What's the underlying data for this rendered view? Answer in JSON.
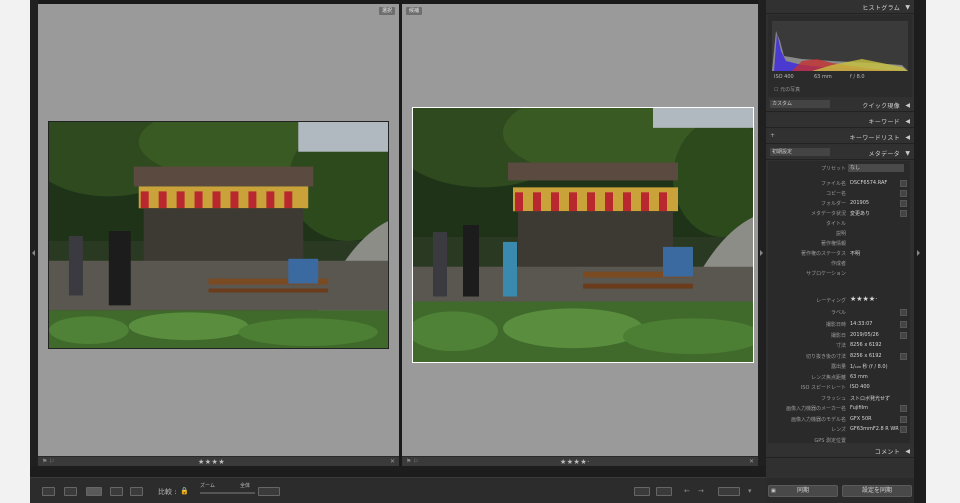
{
  "compare": {
    "left_tag": "選択",
    "right_tag": "候補",
    "left_rating": "★★★★",
    "right_rating": "★★★★·"
  },
  "toolbar": {
    "compare_label": "比較 :",
    "zoom_label": "ズーム",
    "fit_label": "全体"
  },
  "histogram": {
    "title": "ヒストグラム",
    "iso": "ISO 400",
    "focal": "63 mm",
    "aperture": "f / 8.0",
    "original": "元の写真"
  },
  "panels": {
    "quick_develop": "クイック現像",
    "custom": "カスタム",
    "keywords": "キーワード",
    "keyword_list": "キーワードリスト",
    "metadata": "メタデータ",
    "default_preset": "初期設定",
    "comments": "コメント"
  },
  "metadata": {
    "preset_label": "プリセット",
    "preset_value": "なし",
    "rows": [
      {
        "k": "ファイル名",
        "v": "DSCF6574.RAF"
      },
      {
        "k": "コピー名",
        "v": ""
      },
      {
        "k": "フォルダー",
        "v": "201905"
      },
      {
        "k": "メタデータ状況",
        "v": "変更あり"
      },
      {
        "k": "タイトル",
        "v": ""
      },
      {
        "k": "説明",
        "v": ""
      },
      {
        "k": "著作権情報",
        "v": ""
      },
      {
        "k": "著作権のステータス",
        "v": "不明"
      },
      {
        "k": "作成者",
        "v": ""
      },
      {
        "k": "サブロケーション",
        "v": ""
      }
    ],
    "rating_label": "レーティング",
    "rating_value": "★★★★·",
    "label_label": "ラベル",
    "rows2": [
      {
        "k": "撮影日時",
        "v": "14:33:07"
      },
      {
        "k": "撮影日",
        "v": "2019/05/26"
      },
      {
        "k": "寸法",
        "v": "8256 x 6192"
      },
      {
        "k": "切り抜き後の寸法",
        "v": "8256 x 6192"
      },
      {
        "k": "露出量",
        "v": "1/₁₀₀ 秒 (f / 8.0)"
      },
      {
        "k": "レンズ焦点距離",
        "v": "63 mm"
      },
      {
        "k": "ISO スピードレート",
        "v": "ISO 400"
      },
      {
        "k": "フラッシュ",
        "v": "ストロボ発光せず"
      },
      {
        "k": "画像入力機器のメーカー名",
        "v": "Fujifilm"
      },
      {
        "k": "画像入力機器のモデル名",
        "v": "GFX 50R"
      },
      {
        "k": "レンズ",
        "v": "GF63mmF2.8 R WR"
      },
      {
        "k": "GPS 測定位置",
        "v": ""
      }
    ]
  },
  "buttons": {
    "sync": "同期",
    "sync_settings": "設定を同期"
  }
}
